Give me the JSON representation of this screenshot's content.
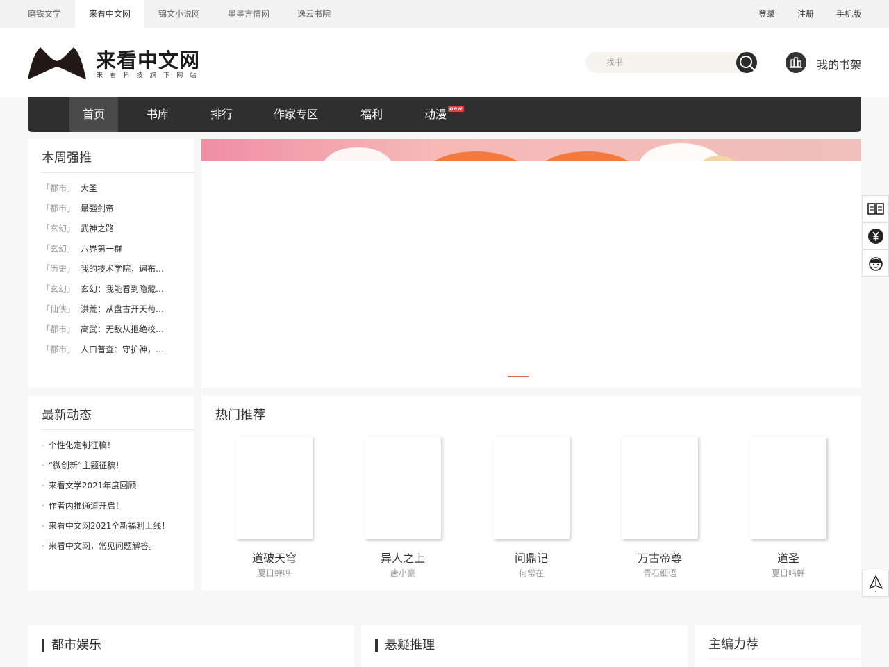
{
  "topbar": {
    "sites": [
      "磨铁文学",
      "来看中文网",
      "锦文小说网",
      "墨墨言情网",
      "逸云书院"
    ],
    "active_site": "来看中文网",
    "login": "登录",
    "register": "注册",
    "mobile": "手机版"
  },
  "header": {
    "logo_title": "来看中文网",
    "logo_subtitle": "来看科技旗下网站",
    "search_placeholder": "找书",
    "bookshelf_label": "我的书架"
  },
  "nav": {
    "items": [
      "首页",
      "书库",
      "排行",
      "作家专区",
      "福利",
      "动漫"
    ],
    "active": "首页",
    "new_badge": "new"
  },
  "weekly": {
    "title": "本周强推",
    "items": [
      {
        "category": "「都市」",
        "name": "大圣"
      },
      {
        "category": "「都市」",
        "name": "最强剑帝"
      },
      {
        "category": "「玄幻」",
        "name": "武神之路"
      },
      {
        "category": "「玄幻」",
        "name": "六界第一群"
      },
      {
        "category": "「历史」",
        "name": "我的技术学院，遍布…"
      },
      {
        "category": "「玄幻」",
        "name": "玄幻：我能看到隐藏…"
      },
      {
        "category": "「仙侠」",
        "name": "洪荒：从盘古开天苟…"
      },
      {
        "category": "「都市」",
        "name": "高武：无敌从拒绝校…"
      },
      {
        "category": "「都市」",
        "name": "人口普查：守护神，…"
      }
    ]
  },
  "news": {
    "title": "最新动态",
    "bullet": "·",
    "items": [
      "个性化定制征稿！",
      "“微创新”主题征稿！",
      "来看文学2021年度回顾",
      "作者内推通道开启！",
      "来看中文网2021全新福利上线！",
      "来看中文网，常见问题解答。"
    ]
  },
  "hot": {
    "title": "热门推荐",
    "books": [
      {
        "title": "道破天穹",
        "author": "夏日蝉鸣"
      },
      {
        "title": "异人之上",
        "author": "唐小豪"
      },
      {
        "title": "问鼎记",
        "author": "何常在"
      },
      {
        "title": "万古帝尊",
        "author": "青石细语"
      },
      {
        "title": "道圣",
        "author": "夏日鸣蝉"
      }
    ]
  },
  "sections": {
    "urban": "都市娱乐",
    "mystery": "悬疑推理",
    "editor": "主编力荐"
  },
  "colors": {
    "nav_bg": "#2f2f2f",
    "accent": "#e06a4a",
    "badge": "#e04040"
  }
}
